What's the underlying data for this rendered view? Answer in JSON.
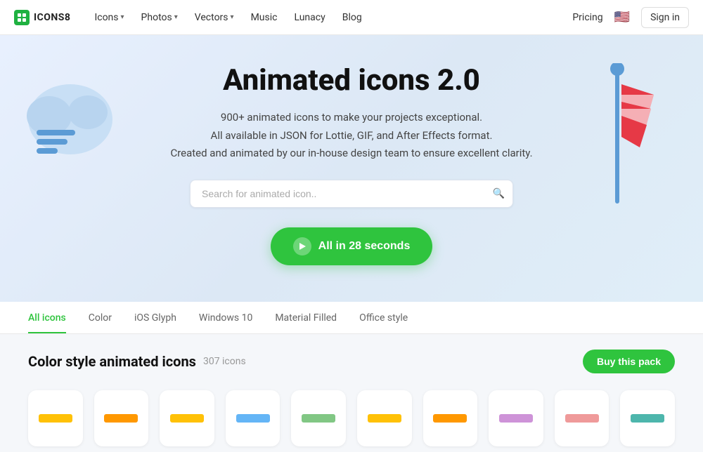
{
  "nav": {
    "logo_text": "ICONS8",
    "links": [
      {
        "label": "Icons",
        "has_dropdown": true
      },
      {
        "label": "Photos",
        "has_dropdown": true
      },
      {
        "label": "Vectors",
        "has_dropdown": true
      },
      {
        "label": "Music",
        "has_dropdown": false
      },
      {
        "label": "Lunacy",
        "has_dropdown": false
      },
      {
        "label": "Blog",
        "has_dropdown": false
      }
    ],
    "pricing": "Pricing",
    "signin": "Sign in"
  },
  "hero": {
    "title": "Animated icons 2.0",
    "line1": "900+ animated icons to make your projects exceptional.",
    "line2": "All available in JSON for Lottie, GIF, and After Effects format.",
    "line3": "Created and animated by our in-house design team to ensure excellent clarity.",
    "search_placeholder": "Search for animated icon..",
    "cta_label": "All in 28 seconds"
  },
  "tabs": [
    {
      "label": "All icons",
      "active": true
    },
    {
      "label": "Color",
      "active": false
    },
    {
      "label": "iOS Glyph",
      "active": false
    },
    {
      "label": "Windows 10",
      "active": false
    },
    {
      "label": "Material Filled",
      "active": false
    },
    {
      "label": "Office style",
      "active": false
    }
  ],
  "section": {
    "title": "Color style animated icons",
    "count": "307 icons",
    "buy_label": "Buy this pack"
  }
}
